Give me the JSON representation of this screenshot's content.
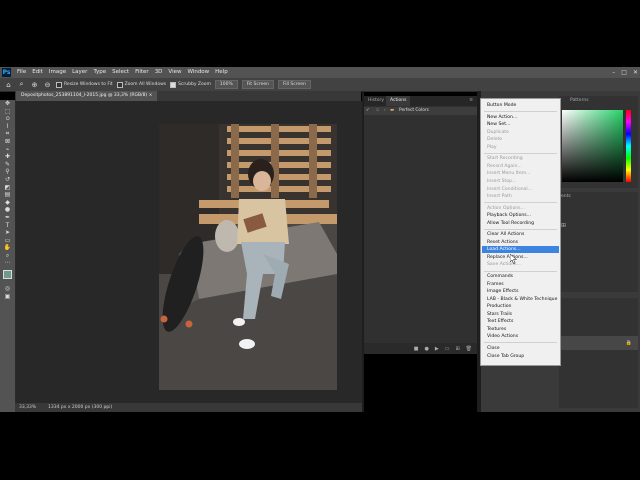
{
  "app": {
    "logo": "Ps"
  },
  "menubar": {
    "items": [
      "File",
      "Edit",
      "Image",
      "Layer",
      "Type",
      "Select",
      "Filter",
      "3D",
      "View",
      "Window",
      "Help"
    ]
  },
  "options_bar": {
    "resize_windows": "Resize Windows to Fit",
    "zoom_all": "Zoom All Windows",
    "scrubby_zoom": "Scrubby Zoom",
    "zoom_100": "100%",
    "fit_screen": "Fit Screen",
    "fill_screen": "Fill Screen"
  },
  "document": {
    "tab_title": "Depositphotos_253891104_l-2015.jpg @ 33,3% (RGB/8)",
    "zoom": "33,33%",
    "dimensions": "1334 px x 2000 px (300 ppi)"
  },
  "actions_panel": {
    "tab_history": "History",
    "tab_actions": "Actions",
    "set_name": "Perfect Colors"
  },
  "color_panel": {
    "tab_patterns": "Patterns"
  },
  "side_panel": {
    "tab_adjustments": "ents"
  },
  "flyout_menu": {
    "items": [
      {
        "label": "Button Mode",
        "disabled": false
      },
      {
        "sep": true
      },
      {
        "label": "New Action...",
        "disabled": false
      },
      {
        "label": "New Set...",
        "disabled": false
      },
      {
        "label": "Duplicate",
        "disabled": true
      },
      {
        "label": "Delete",
        "disabled": true
      },
      {
        "label": "Play",
        "disabled": true
      },
      {
        "sep": true
      },
      {
        "label": "Start Recording",
        "disabled": true
      },
      {
        "label": "Record Again...",
        "disabled": true
      },
      {
        "label": "Insert Menu Item...",
        "disabled": true
      },
      {
        "label": "Insert Stop...",
        "disabled": true
      },
      {
        "label": "Insert Conditional...",
        "disabled": true
      },
      {
        "label": "Insert Path",
        "disabled": true
      },
      {
        "sep": true
      },
      {
        "label": "Action Options...",
        "disabled": true
      },
      {
        "label": "Playback Options...",
        "disabled": false
      },
      {
        "label": "Allow Tool Recording",
        "disabled": false
      },
      {
        "sep": true
      },
      {
        "label": "Clear All Actions",
        "disabled": false
      },
      {
        "label": "Reset Actions",
        "disabled": false
      },
      {
        "label": "Load Actions...",
        "disabled": false,
        "highlighted": true
      },
      {
        "label": "Replace Actions...",
        "disabled": false
      },
      {
        "label": "Save Actions...",
        "disabled": true
      },
      {
        "sep": true
      },
      {
        "label": "Commands",
        "disabled": false
      },
      {
        "label": "Frames",
        "disabled": false
      },
      {
        "label": "Image Effects",
        "disabled": false
      },
      {
        "label": "LAB - Black & White Technique",
        "disabled": false
      },
      {
        "label": "Production",
        "disabled": false
      },
      {
        "label": "Stars Trails",
        "disabled": false
      },
      {
        "label": "Text Effects",
        "disabled": false
      },
      {
        "label": "Textures",
        "disabled": false
      },
      {
        "label": "Video Actions",
        "disabled": false
      },
      {
        "sep": true
      },
      {
        "label": "Close",
        "disabled": false
      },
      {
        "label": "Close Tab Group",
        "disabled": false
      }
    ]
  },
  "colors": {
    "highlight": "#3d84e0",
    "color_green": "#27d36b",
    "foreground": "#6e9b8a"
  }
}
